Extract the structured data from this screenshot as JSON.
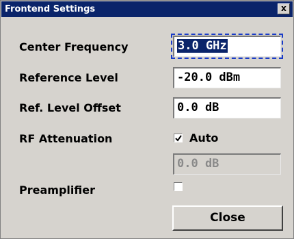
{
  "window": {
    "title": "Frontend Settings",
    "close_glyph": "x"
  },
  "fields": {
    "center_frequency": {
      "label": "Center Frequency",
      "value": "3.0 GHz"
    },
    "reference_level": {
      "label": "Reference Level",
      "value": "-20.0 dBm"
    },
    "ref_level_offset": {
      "label": "Ref. Level Offset",
      "value": "0.0 dB"
    },
    "rf_attenuation": {
      "label": "RF Attenuation",
      "auto_label": "Auto",
      "auto_checked": true,
      "value": "0.0 dB"
    },
    "preamplifier": {
      "label": "Preamplifier",
      "checked": false
    }
  },
  "buttons": {
    "close_label": "Close"
  },
  "colors": {
    "titlebar": "#0a246a",
    "dialog_bg": "#d6d3ce",
    "focus_ring": "#1a3cc8"
  }
}
